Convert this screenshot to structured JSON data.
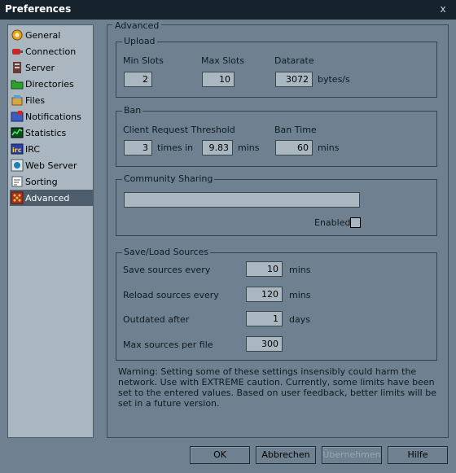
{
  "window": {
    "title": "Preferences",
    "close_glyph": "x"
  },
  "sidebar": {
    "items": [
      {
        "label": "General",
        "icon": "gear-icon"
      },
      {
        "label": "Connection",
        "icon": "plug-icon"
      },
      {
        "label": "Server",
        "icon": "server-icon"
      },
      {
        "label": "Directories",
        "icon": "folder-icon"
      },
      {
        "label": "Files",
        "icon": "files-icon"
      },
      {
        "label": "Notifications",
        "icon": "notification-icon"
      },
      {
        "label": "Statistics",
        "icon": "chart-icon"
      },
      {
        "label": "IRC",
        "icon": "irc-icon"
      },
      {
        "label": "Web Server",
        "icon": "globe-icon"
      },
      {
        "label": "Sorting",
        "icon": "sort-icon"
      },
      {
        "label": "Advanced",
        "icon": "advanced-icon"
      }
    ],
    "selected": "Advanced"
  },
  "section": {
    "title": "Advanced",
    "upload": {
      "legend": "Upload",
      "min_slots_label": "Min Slots",
      "min_slots": "2",
      "max_slots_label": "Max Slots",
      "max_slots": "10",
      "datarate_label": "Datarate",
      "datarate": "3072",
      "datarate_unit": "bytes/s"
    },
    "ban": {
      "legend": "Ban",
      "threshold_label": "Client Request Threshold",
      "threshold_times": "3",
      "times_in": "times in",
      "threshold_mins": "9.83",
      "mins": "mins",
      "ban_time_label": "Ban Time",
      "ban_time": "60",
      "ban_time_unit": "mins"
    },
    "community": {
      "legend": "Community Sharing",
      "value": "",
      "enabled_label": "Enabled",
      "enabled": false
    },
    "sources": {
      "legend": "Save/Load Sources",
      "save_label": "Save sources every",
      "save": "10",
      "save_unit": "mins",
      "reload_label": "Reload sources every",
      "reload": "120",
      "reload_unit": "mins",
      "outdated_label": "Outdated after",
      "outdated": "1",
      "outdated_unit": "days",
      "max_label": "Max sources per file",
      "max": "300"
    },
    "warning": "Warning: Setting some of these settings insensibly could harm the network. Use with EXTREME caution. Currently, some limits have been set to the entered values. Based on user feedback, better limits will be set in a future version."
  },
  "buttons": {
    "ok": "OK",
    "cancel": "Abbrechen",
    "apply": "Übernehmen",
    "help": "Hilfe"
  }
}
